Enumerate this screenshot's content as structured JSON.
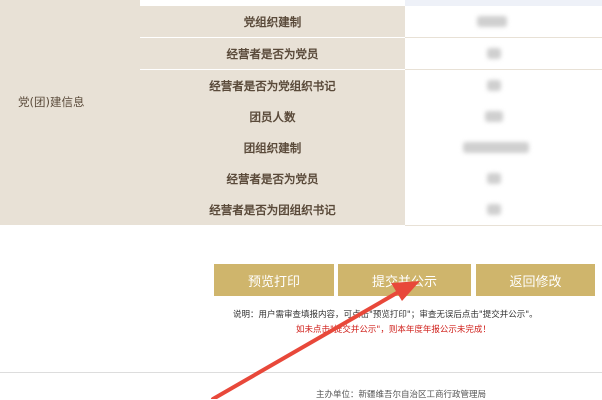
{
  "group_label": "党(团)建信息",
  "rows": [
    {
      "label": "党组织建制"
    },
    {
      "label": "经营者是否为党员"
    },
    {
      "label": "经营者是否为党组织书记"
    },
    {
      "label": "团员人数"
    },
    {
      "label": "团组织建制"
    },
    {
      "label": "经营者是否为党员"
    },
    {
      "label": "经营者是否为团组织书记"
    }
  ],
  "buttons": {
    "preview": "预览打印",
    "submit": "提交并公示",
    "back": "返回修改"
  },
  "note_line1": "说明：用户需审查填报内容，可点击\"预览打印\"；审查无误后点击\"提交并公示\"。",
  "note_line2": "如未点击\"提交并公示\"，则本年度年报公示未完成！",
  "footer": "主办单位：新疆维吾尔自治区工商行政管理局",
  "colors": {
    "label_bg": "#e8e1d6",
    "button_bg": "#cfb56c",
    "arrow": "#e8483a",
    "warning": "#d0201b"
  }
}
